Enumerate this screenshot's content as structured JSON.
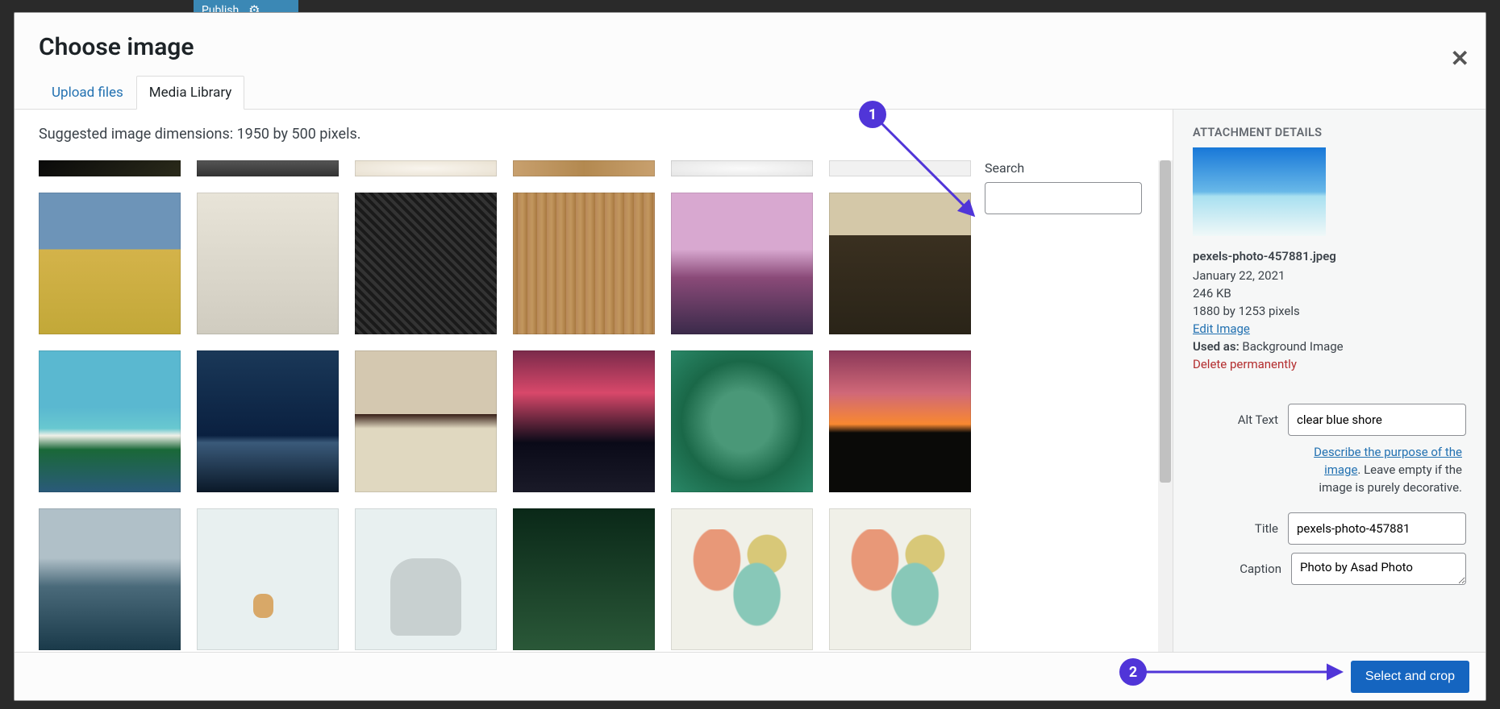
{
  "bg": {
    "publish": "Publish"
  },
  "modal": {
    "title": "Choose image",
    "close_label": "✕",
    "tabs": {
      "upload": "Upload files",
      "library": "Media Library"
    },
    "dim_note": "Suggested image dimensions: 1950 by 500 pixels.",
    "search_label": "Search"
  },
  "attachment": {
    "header": "ATTACHMENT DETAILS",
    "filename": "pexels-photo-457881.jpeg",
    "date": "January 22, 2021",
    "size": "246 KB",
    "dimensions": "1880 by 1253 pixels",
    "edit_image": "Edit Image",
    "used_as_label": "Used as:",
    "used_as_value": "Background Image",
    "delete": "Delete permanently",
    "alt_label": "Alt Text",
    "alt_value": "clear blue shore",
    "help_link": "Describe the purpose of the image",
    "help_rest": ". Leave empty if the image is purely decorative.",
    "title_label": "Title",
    "title_value": "pexels-photo-457881",
    "caption_label": "Caption",
    "caption_value": "Photo by Asad Photo"
  },
  "toolbar": {
    "select_crop": "Select and crop"
  },
  "annotations": {
    "one": "1",
    "two": "2"
  }
}
